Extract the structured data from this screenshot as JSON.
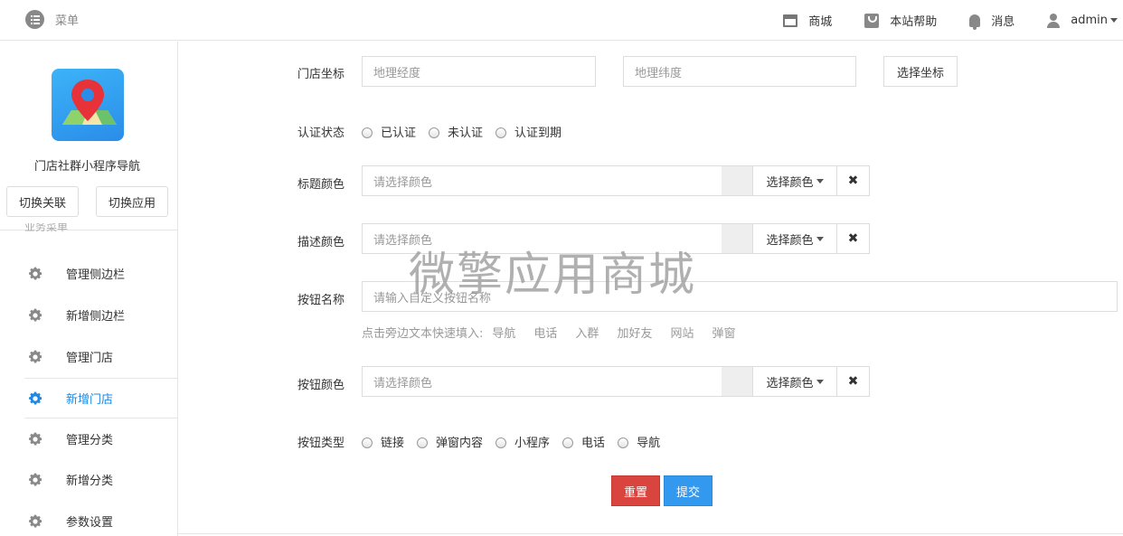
{
  "topbar": {
    "menu_label": "菜单",
    "nav": [
      {
        "label": "商城",
        "icon": "store-icon"
      },
      {
        "label": "本站帮助",
        "icon": "help-icon"
      },
      {
        "label": "消息",
        "icon": "bell-icon"
      },
      {
        "label": "admin",
        "icon": "user-icon"
      }
    ]
  },
  "sidebar": {
    "app_name": "门店社群小程序导航",
    "switch_link_label": "切换关联",
    "switch_app_label": "切换应用",
    "section_title": "业务菜单",
    "items": [
      {
        "label": "管理侧边栏"
      },
      {
        "label": "新增侧边栏"
      },
      {
        "label": "管理门店"
      },
      {
        "label": "新增门店",
        "active": true
      },
      {
        "label": "管理分类"
      },
      {
        "label": "新增分类"
      },
      {
        "label": "参数设置"
      }
    ],
    "accent_color": "#1e88e5"
  },
  "form": {
    "coords": {
      "label": "门店坐标",
      "lng_placeholder": "地理经度",
      "lat_placeholder": "地理纬度",
      "pick_button": "选择坐标"
    },
    "auth_status": {
      "label": "认证状态",
      "options": [
        "已认证",
        "未认证",
        "认证到期"
      ]
    },
    "title_color": {
      "label": "标题颜色",
      "placeholder": "请选择颜色",
      "pick_label": "选择颜色"
    },
    "desc_color": {
      "label": "描述颜色",
      "placeholder": "请选择颜色",
      "pick_label": "选择颜色"
    },
    "button_name": {
      "label": "按钮名称",
      "placeholder": "请输入自定义按钮名称",
      "quick_fill_label": "点击旁边文本快速填入:",
      "quick_fill_options": [
        "导航",
        "电话",
        "入群",
        "加好友",
        "网站",
        "弹窗"
      ]
    },
    "button_color": {
      "label": "按钮颜色",
      "placeholder": "请选择颜色",
      "pick_label": "选择颜色"
    },
    "button_type": {
      "label": "按钮类型",
      "options": [
        "链接",
        "弹窗内容",
        "小程序",
        "电话",
        "导航"
      ]
    },
    "reset_label": "重置",
    "submit_label": "提交",
    "clear_glyph": "✖"
  },
  "watermark": "微擎应用商城",
  "colors": {
    "reset": "#d9443f",
    "submit": "#3399ee"
  }
}
